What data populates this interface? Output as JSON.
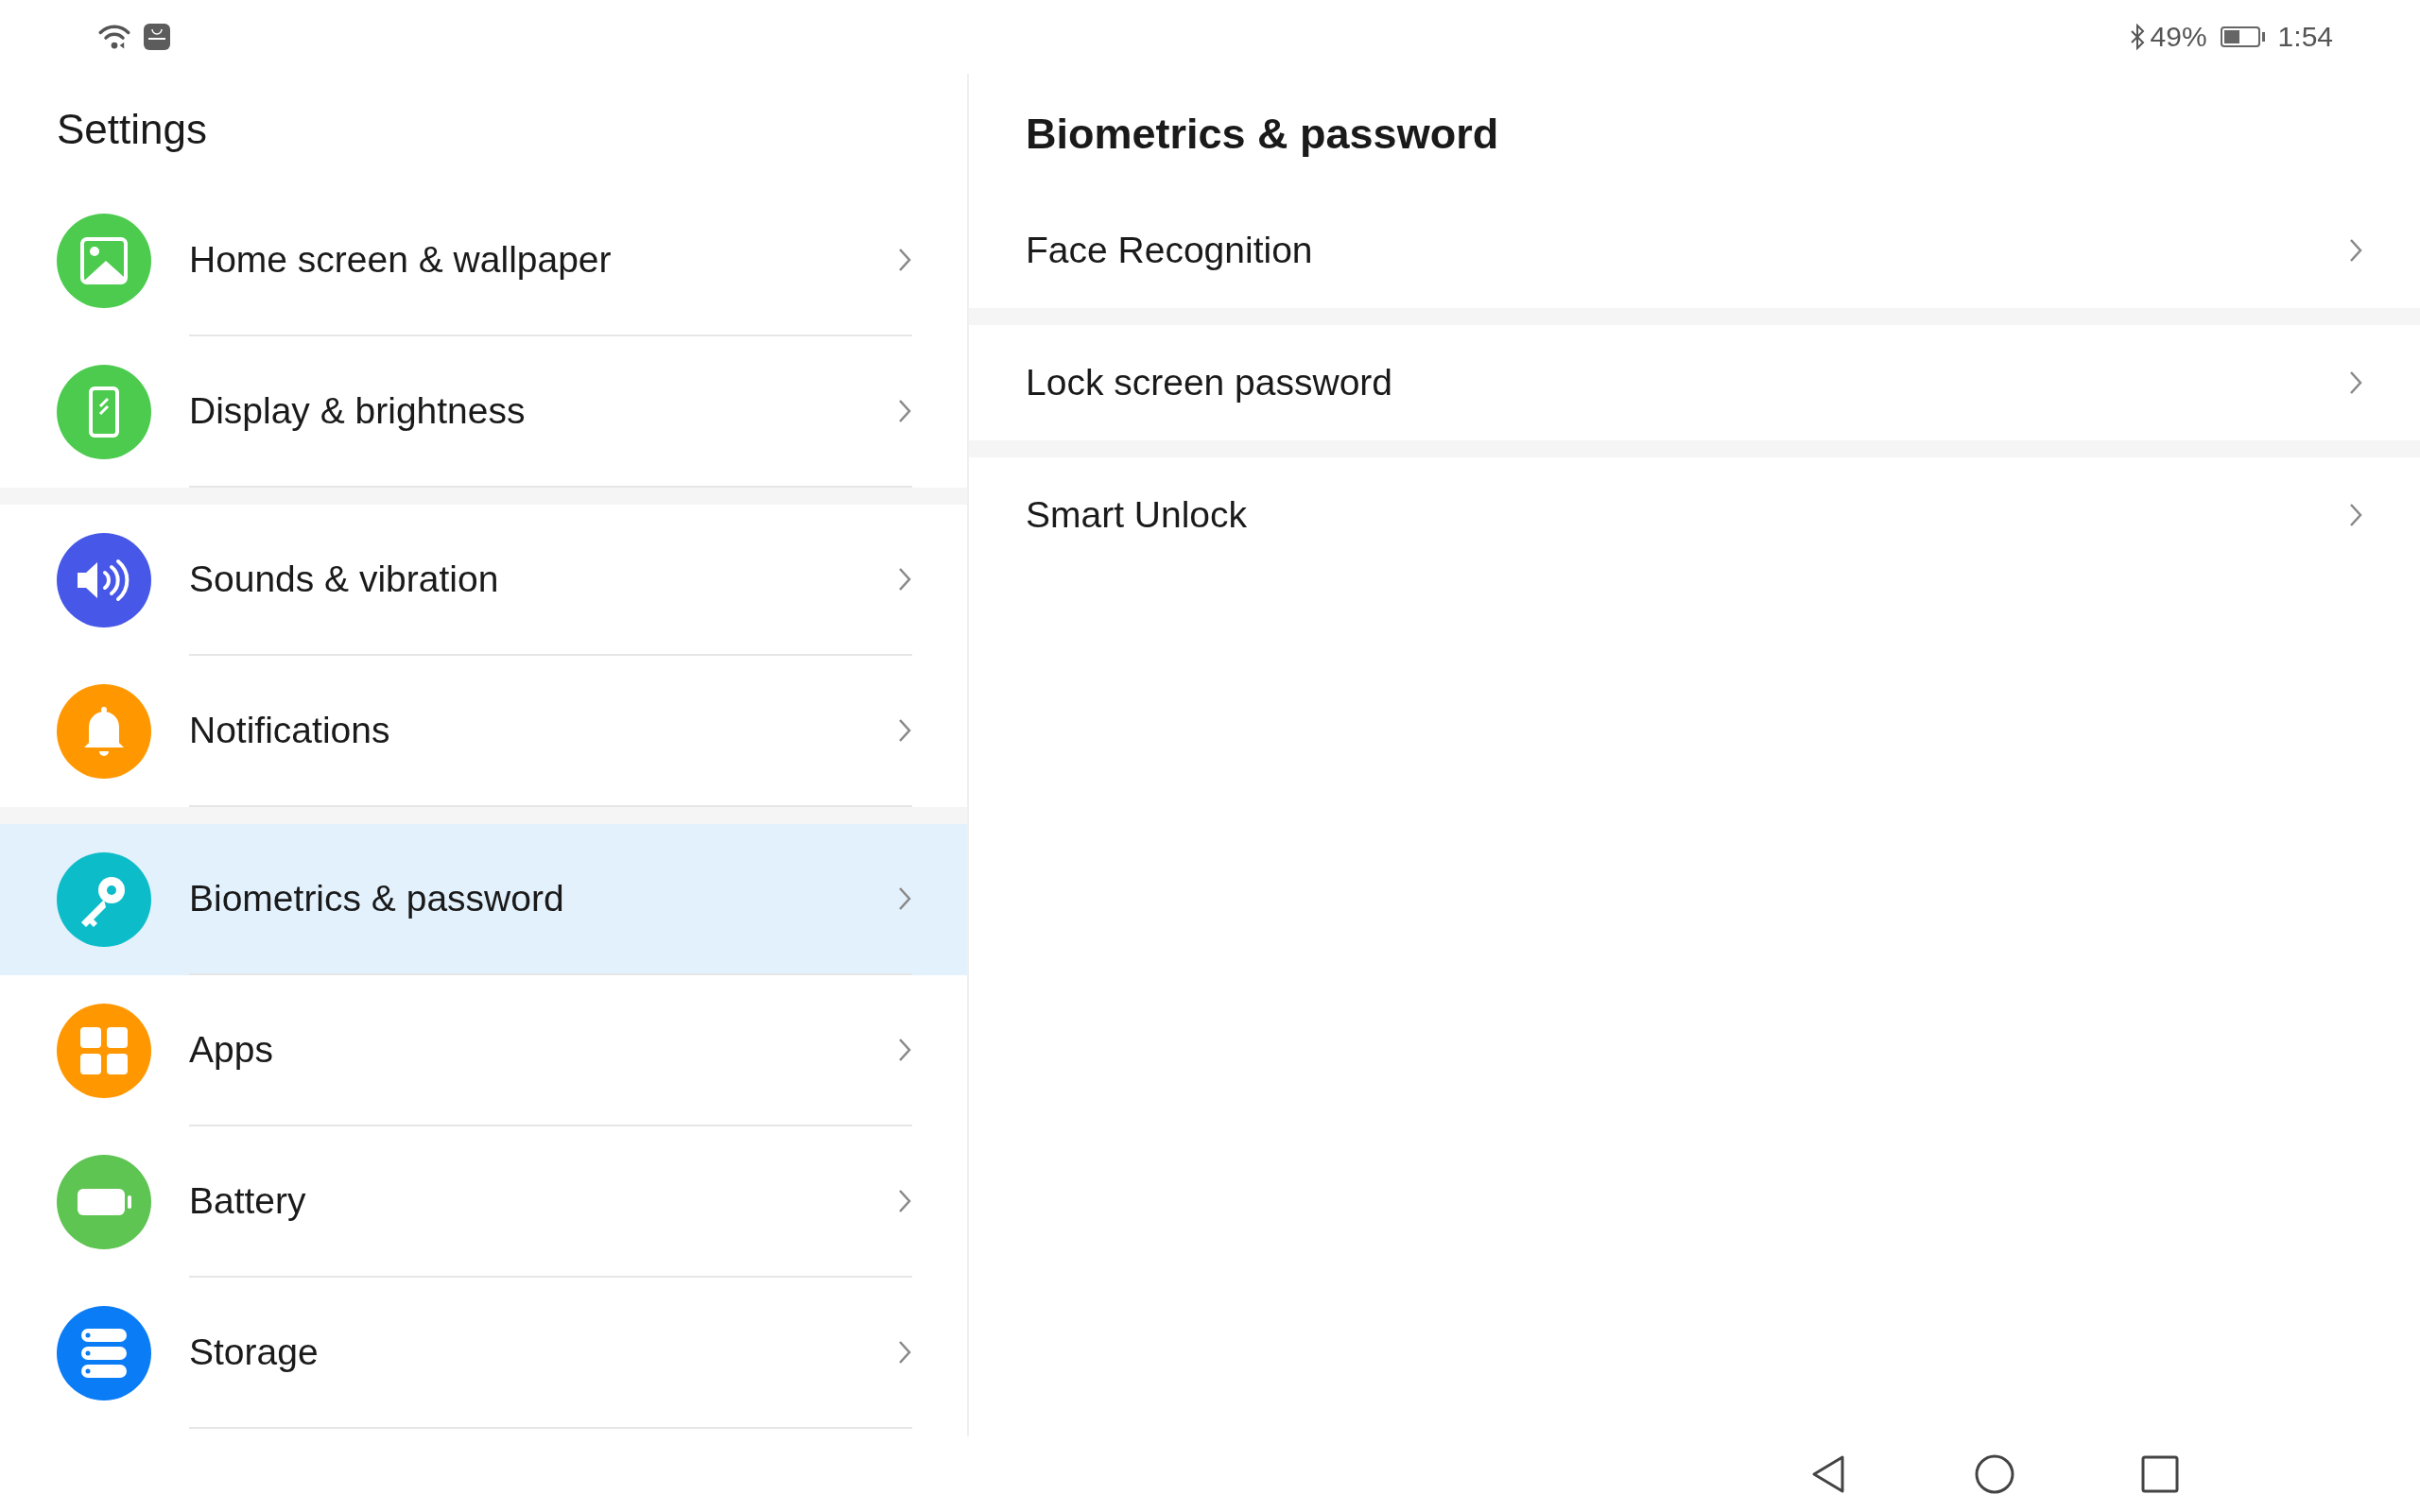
{
  "status_bar": {
    "bluetooth": true,
    "battery_percent": "49%",
    "battery": {
      "level": 0.49
    },
    "time": "1:54"
  },
  "sidebar": {
    "title": "Settings",
    "groups": [
      [
        {
          "label": "Home screen & wallpaper",
          "kind": "picture",
          "color": "#4ccb4f",
          "selected": false
        },
        {
          "label": "Display & brightness",
          "kind": "phone",
          "color": "#4ccb4f",
          "selected": false
        }
      ],
      [
        {
          "label": "Sounds & vibration",
          "kind": "speaker",
          "color": "#4757e8",
          "selected": false
        },
        {
          "label": "Notifications",
          "kind": "bell",
          "color": "#ff9800",
          "selected": false
        }
      ],
      [
        {
          "label": "Biometrics & password",
          "kind": "key",
          "color": "#0cbdc9",
          "selected": true
        },
        {
          "label": "Apps",
          "kind": "grid",
          "color": "#ff9800",
          "selected": false
        },
        {
          "label": "Battery",
          "kind": "battery",
          "color": "#5ec452",
          "selected": false
        },
        {
          "label": "Storage",
          "kind": "storage",
          "color": "#0a7cf5",
          "selected": false
        }
      ]
    ]
  },
  "detail": {
    "title": "Biometrics & password",
    "items": [
      {
        "label": "Face Recognition"
      },
      {
        "label": "Lock screen password"
      },
      {
        "label": "Smart Unlock"
      }
    ]
  }
}
